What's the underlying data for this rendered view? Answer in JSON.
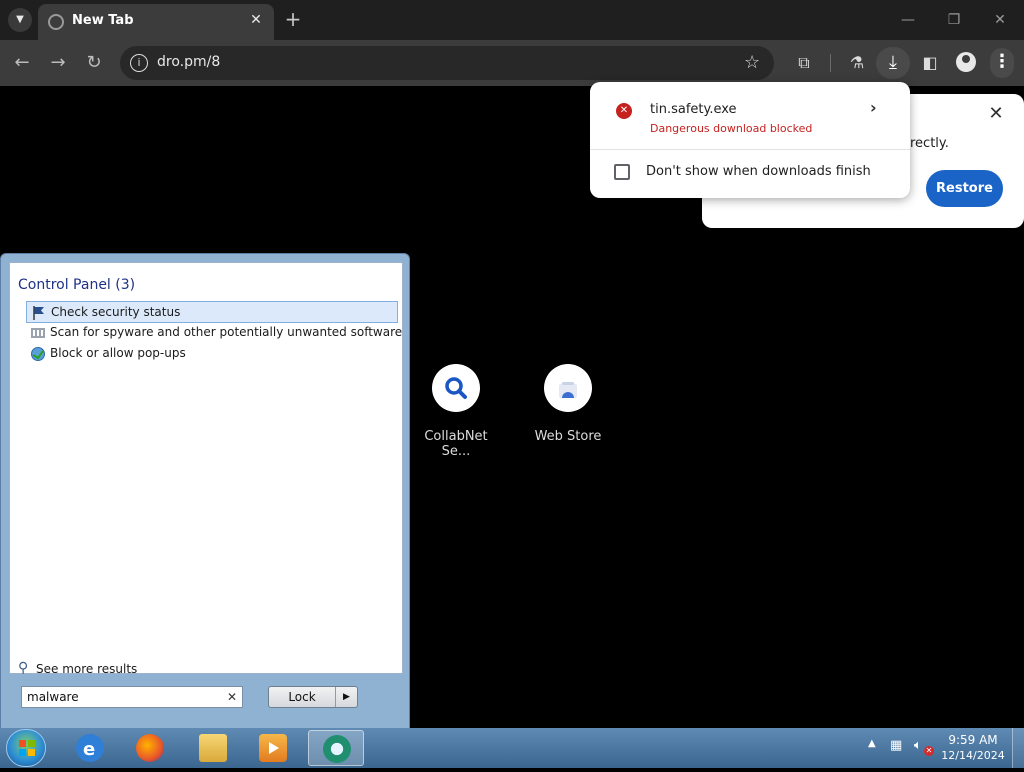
{
  "browser": {
    "tab_title": "New Tab",
    "tab_close": "✕",
    "new_tab": "+",
    "url": "dro.pm/8",
    "window_controls": {
      "minimize": "—",
      "restore": "❐",
      "close": "✕"
    }
  },
  "shortcuts": [
    {
      "label": "CollabNet Se...",
      "icon": "search-icon"
    },
    {
      "label": "Web Store",
      "icon": "web-store-icon"
    }
  ],
  "restore_card": {
    "text": "rectly.",
    "restore_label": "Restore",
    "close": "✕"
  },
  "download_bubble": {
    "filename": "tin.safety.exe",
    "status": "Dangerous download blocked",
    "checkbox_label": "Don't show when downloads finish",
    "checkbox_checked": false,
    "status_color": "#c5221f"
  },
  "start_menu": {
    "results_header": "Control Panel (3)",
    "results": [
      {
        "label": "Check security status",
        "icon": "action-center-flag-icon",
        "selected": true
      },
      {
        "label": "Scan for spyware and other potentially unwanted software",
        "icon": "windows-defender-icon",
        "selected": false
      },
      {
        "label": "Block or allow pop-ups",
        "icon": "internet-options-icon",
        "selected": false
      }
    ],
    "see_more": "See more results",
    "search_value": "malware",
    "search_clear": "✕",
    "lock_label": "Lock"
  },
  "taskbar": {
    "apps": [
      "internet-explorer-icon",
      "firefox-icon",
      "file-explorer-icon",
      "media-player-icon",
      "chrome-icon"
    ],
    "clock_time": "9:59 AM",
    "clock_date": "12/14/2024"
  }
}
